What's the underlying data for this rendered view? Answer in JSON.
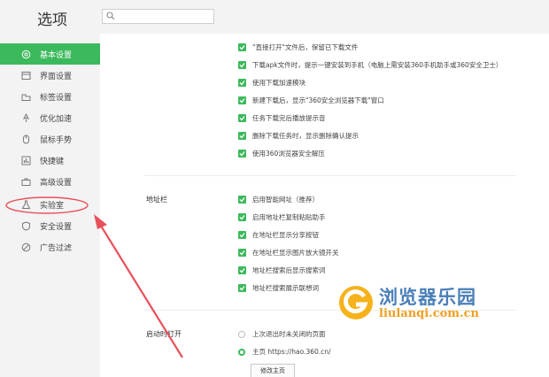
{
  "header": {
    "title": "选项",
    "search_placeholder": ""
  },
  "sidebar": {
    "items": [
      {
        "label": "基本设置",
        "icon": "gear-icon",
        "active": true
      },
      {
        "label": "界面设置",
        "icon": "window-icon",
        "active": false
      },
      {
        "label": "标签设置",
        "icon": "tab-icon",
        "active": false
      },
      {
        "label": "优化加速",
        "icon": "rocket-icon",
        "active": false
      },
      {
        "label": "鼠标手势",
        "icon": "mouse-icon",
        "active": false
      },
      {
        "label": "快捷键",
        "icon": "chart-icon",
        "active": false
      },
      {
        "label": "高级设置",
        "icon": "toolbox-icon",
        "active": false
      },
      {
        "label": "实验室",
        "icon": "flask-icon",
        "active": false
      },
      {
        "label": "安全设置",
        "icon": "shield-icon",
        "active": false
      },
      {
        "label": "广告过滤",
        "icon": "block-icon",
        "active": false
      }
    ]
  },
  "download": {
    "options": [
      "\"直接打开\"文件后，保留已下载文件",
      "下载apk文件时，提示一键安装到手机（电脑上需安装360手机助手或360安全卫士）",
      "使用下载加速模块",
      "新建下载后，显示\"360安全浏览器下载\"窗口",
      "任务下载完后播放提示音",
      "删除下载任务时，显示删除确认提示",
      "使用360浏览器安全解压"
    ]
  },
  "address_bar": {
    "label": "地址栏",
    "options": [
      "启用智能网址（推荐）",
      "启用地址栏复制粘贴助手",
      "在地址栏显示分享按钮",
      "在地址栏显示图片放大镜开关",
      "地址栏搜索后显示搜索词",
      "地址栏搜索展示联想词"
    ]
  },
  "startup": {
    "label": "启动时打开",
    "options": [
      {
        "label": "上次退出时未关闭的页面",
        "selected": false
      },
      {
        "label": "主页  https://hao.360.cn/",
        "selected": true
      }
    ],
    "edit_button": "修改主页"
  },
  "watermark": {
    "name": "浏览器乐园",
    "url": "liulanqi.com.cn"
  },
  "colors": {
    "accent": "#3cb95c",
    "annotation": "#e8505b"
  }
}
